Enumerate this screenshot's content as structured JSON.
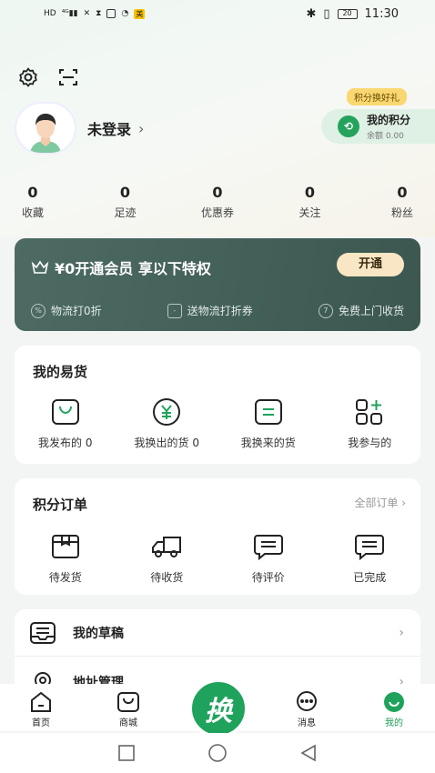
{
  "status_bar": {
    "left_icons": [
      "HD",
      "4G signal",
      "wifi-off",
      "hourglass",
      "battery-saver",
      "app-icon",
      "美"
    ],
    "badge": "美",
    "right_indicators": [
      "bluetooth-icon",
      "vibrate-icon",
      "battery-icon"
    ],
    "battery_level": "20",
    "time": "11:30"
  },
  "header": {
    "settings_icon": "gear-icon",
    "scan_icon": "scan-icon"
  },
  "profile": {
    "login_text": "未登录",
    "chevron": "›"
  },
  "points": {
    "tag": "积分换好礼",
    "title": "我的积分",
    "balance": "余额 0.00"
  },
  "stats": [
    {
      "value": "0",
      "label": "收藏"
    },
    {
      "value": "0",
      "label": "足迹"
    },
    {
      "value": "0",
      "label": "优惠券"
    },
    {
      "value": "0",
      "label": "关注"
    },
    {
      "value": "0",
      "label": "粉丝"
    }
  ],
  "vip": {
    "title": "¥0开通会员 享以下特权",
    "button": "开通",
    "perks": [
      {
        "icon": "%",
        "label": "物流打0折"
      },
      {
        "icon": "-",
        "label": "送物流打折券"
      },
      {
        "icon": "7",
        "label": "免费上门收货"
      }
    ]
  },
  "my_goods": {
    "title": "我的易货",
    "items": [
      {
        "icon": "bag-icon",
        "label": "我发布的 0"
      },
      {
        "icon": "yen-icon",
        "label": "我换出的货 0"
      },
      {
        "icon": "equal-icon",
        "label": "我换来的货"
      },
      {
        "icon": "grid-plus-icon",
        "label": "我参与的"
      }
    ]
  },
  "points_orders": {
    "title": "积分订单",
    "more": "全部订单 ›",
    "items": [
      {
        "icon": "box-icon",
        "label": "待发货"
      },
      {
        "icon": "truck-icon",
        "label": "待收货"
      },
      {
        "icon": "comment-icon",
        "label": "待评价"
      },
      {
        "icon": "done-icon",
        "label": "已完成"
      }
    ]
  },
  "list": [
    {
      "icon": "drafts-icon",
      "label": "我的草稿",
      "chevron": "›"
    },
    {
      "icon": "location-icon",
      "label": "地址管理",
      "chevron": "›"
    }
  ],
  "tabbar": {
    "tabs": [
      {
        "icon": "home-icon",
        "label": "首页"
      },
      {
        "icon": "mall-icon",
        "label": "商城"
      },
      {
        "icon": "exchange-icon",
        "label": "换"
      },
      {
        "icon": "message-icon",
        "label": "消息"
      },
      {
        "icon": "mine-icon",
        "label": "我的"
      }
    ],
    "active_color": "#1f9d55"
  },
  "colors": {
    "brand_green": "#1fa35c",
    "vip_bg": "#4d6b63",
    "vip_button": "#f9e6c4",
    "points_tag": "#f9d872"
  }
}
